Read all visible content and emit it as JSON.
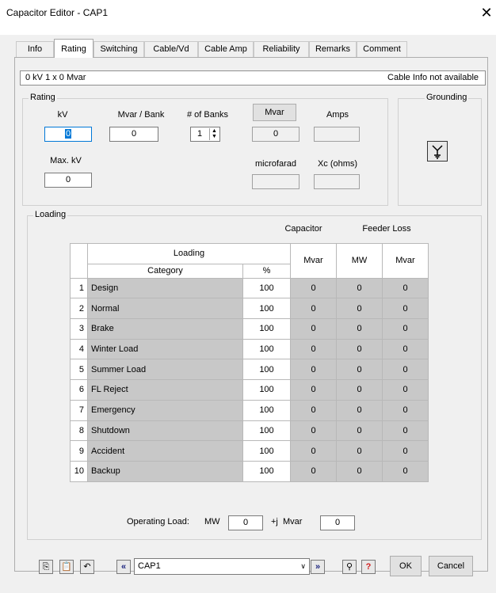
{
  "window": {
    "title": "Capacitor Editor - CAP1",
    "close_glyph": "✕"
  },
  "tabs": [
    "Info",
    "Rating",
    "Switching",
    "Cable/Vd",
    "Cable Amp",
    "Reliability",
    "Remarks",
    "Comment"
  ],
  "active_tab": "Rating",
  "info_bar": {
    "left": "0 kV  1 x 0 Mvar",
    "right": "Cable Info not available"
  },
  "rating": {
    "legend": "Rating",
    "kv_label": "kV",
    "kv_value": "0",
    "mvar_bank_label": "Mvar / Bank",
    "mvar_bank_value": "0",
    "banks_label": "# of Banks",
    "banks_value": "1",
    "mvar_button": "Mvar",
    "mvar_value": "0",
    "amps_label": "Amps",
    "amps_value": "",
    "maxkv_label": "Max. kV",
    "maxkv_value": "0",
    "microfarad_label": "microfarad",
    "microfarad_value": "",
    "xc_label": "Xc (ohms)",
    "xc_value": ""
  },
  "grounding": {
    "legend": "Grounding",
    "icon": "wye-ground-icon"
  },
  "loading": {
    "legend": "Loading",
    "capacitor_label": "Capacitor",
    "feeder_loss_label": "Feeder Loss",
    "columns": {
      "group": "Loading",
      "category": "Category",
      "percent": "%",
      "mvar": "Mvar",
      "mw": "MW",
      "loss_mvar": "Mvar"
    },
    "rows": [
      {
        "n": "1",
        "category": "Design",
        "percent": "100",
        "mvar": "0",
        "mw": "0",
        "loss_mvar": "0"
      },
      {
        "n": "2",
        "category": "Normal",
        "percent": "100",
        "mvar": "0",
        "mw": "0",
        "loss_mvar": "0"
      },
      {
        "n": "3",
        "category": "Brake",
        "percent": "100",
        "mvar": "0",
        "mw": "0",
        "loss_mvar": "0"
      },
      {
        "n": "4",
        "category": "Winter Load",
        "percent": "100",
        "mvar": "0",
        "mw": "0",
        "loss_mvar": "0"
      },
      {
        "n": "5",
        "category": "Summer Load",
        "percent": "100",
        "mvar": "0",
        "mw": "0",
        "loss_mvar": "0"
      },
      {
        "n": "6",
        "category": "FL Reject",
        "percent": "100",
        "mvar": "0",
        "mw": "0",
        "loss_mvar": "0"
      },
      {
        "n": "7",
        "category": "Emergency",
        "percent": "100",
        "mvar": "0",
        "mw": "0",
        "loss_mvar": "0"
      },
      {
        "n": "8",
        "category": "Shutdown",
        "percent": "100",
        "mvar": "0",
        "mw": "0",
        "loss_mvar": "0"
      },
      {
        "n": "9",
        "category": "Accident",
        "percent": "100",
        "mvar": "0",
        "mw": "0",
        "loss_mvar": "0"
      },
      {
        "n": "10",
        "category": "Backup",
        "percent": "100",
        "mvar": "0",
        "mw": "0",
        "loss_mvar": "0"
      }
    ],
    "operating_load_label": "Operating Load:",
    "mw_label": "MW",
    "mw_value": "0",
    "j_mvar_label": "+j  Mvar",
    "mvar_value": "0"
  },
  "bottom_bar": {
    "selected_id": "CAP1",
    "ok_label": "OK",
    "cancel_label": "Cancel",
    "colors": {
      "help_red": "#d21e1e",
      "nav_blue": "#1a237e"
    }
  }
}
